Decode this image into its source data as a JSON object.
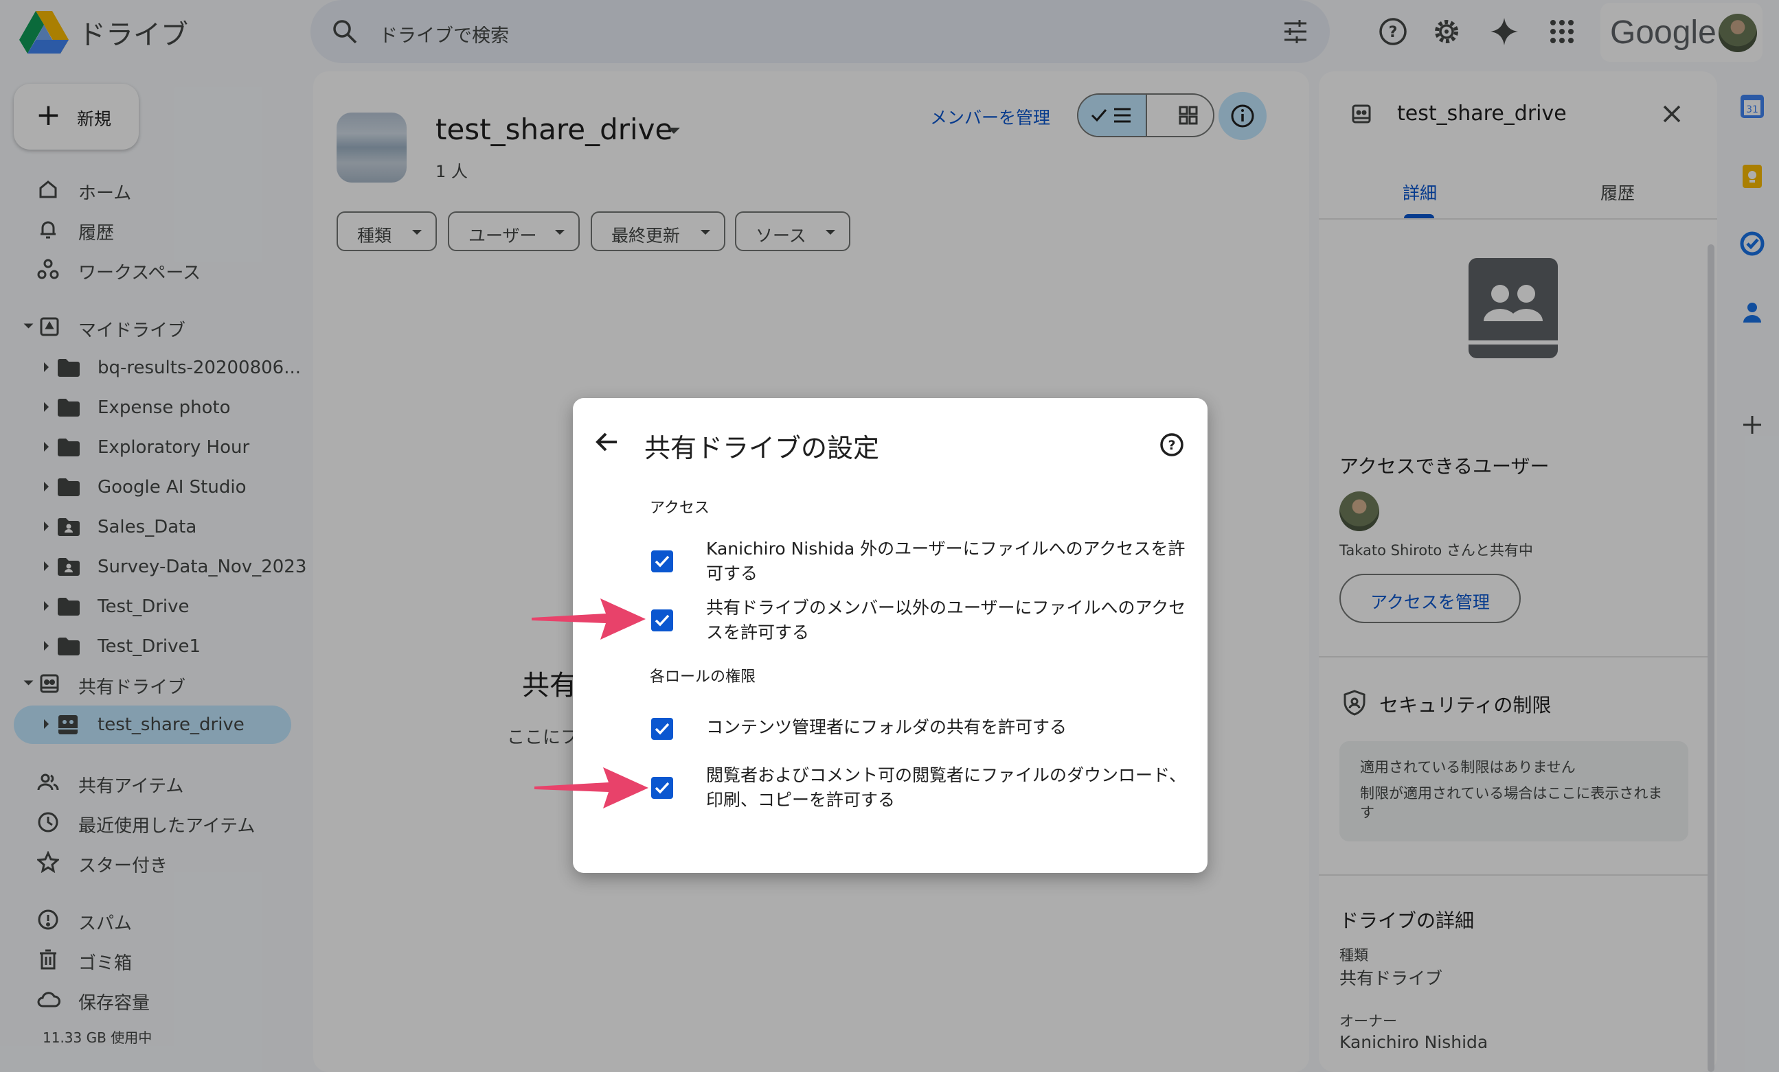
{
  "header": {
    "app_title": "ドライブ",
    "search_placeholder": "ドライブで検索",
    "google_word": "Google"
  },
  "sidebar": {
    "new_label": "新規",
    "nav_top": [
      {
        "label": "ホーム",
        "icon": "home-icon"
      },
      {
        "label": "履歴",
        "icon": "bell-icon"
      },
      {
        "label": "ワークスペース",
        "icon": "workspaces-icon"
      }
    ],
    "my_drive": {
      "label": "マイドライブ",
      "folders": [
        {
          "label": "bq-results-20200806...",
          "icon": "folder-icon"
        },
        {
          "label": "Expense photo",
          "icon": "folder-icon"
        },
        {
          "label": "Exploratory Hour",
          "icon": "folder-icon"
        },
        {
          "label": "Google AI Studio",
          "icon": "folder-icon"
        },
        {
          "label": "Sales_Data",
          "icon": "shared-folder-icon"
        },
        {
          "label": "Survey-Data_Nov_2023",
          "icon": "shared-folder-icon"
        },
        {
          "label": "Test_Drive",
          "icon": "folder-icon"
        },
        {
          "label": "Test_Drive1",
          "icon": "folder-icon"
        }
      ]
    },
    "shared_drives": {
      "label": "共有ドライブ",
      "items": [
        {
          "label": "test_share_drive"
        }
      ]
    },
    "nav_mid": [
      {
        "label": "共有アイテム",
        "icon": "people-icon"
      },
      {
        "label": "最近使用したアイテム",
        "icon": "clock-icon"
      },
      {
        "label": "スター付き",
        "icon": "star-icon"
      }
    ],
    "nav_bottom": [
      {
        "label": "スパム",
        "icon": "spam-icon"
      },
      {
        "label": "ゴミ箱",
        "icon": "trash-icon"
      },
      {
        "label": "保存容量",
        "icon": "cloud-icon"
      }
    ],
    "storage_used": "11.33 GB 使用中"
  },
  "main": {
    "drive_name": "test_share_drive",
    "member_count": "1 人",
    "manage_members": "メンバーを管理",
    "filters": [
      "種類",
      "ユーザー",
      "最終更新",
      "ソース"
    ],
    "empty_title": "共有",
    "empty_sub": "ここにフ"
  },
  "details_panel": {
    "title": "test_share_drive",
    "tabs": [
      "詳細",
      "履歴"
    ],
    "access_heading": "アクセスできるユーザー",
    "shared_with": "Takato Shiroto さんと共有中",
    "manage_access": "アクセスを管理",
    "security_heading": "セキュリティの制限",
    "security_line1": "適用されている制限はありません",
    "security_line2": "制限が適用されている場合はここに表示されます",
    "drive_details_heading": "ドライブの詳細",
    "type_label": "種類",
    "type_value": "共有ドライブ",
    "owner_label": "オーナー",
    "owner_value": "Kanichiro Nishida"
  },
  "dialog": {
    "title": "共有ドライブの設定",
    "access_section": "アクセス",
    "access_options": [
      {
        "text": "Kanichiro Nishida 外のユーザーにファイルへのアクセスを許可する",
        "checked": true
      },
      {
        "text": "共有ドライブのメンバー以外のユーザーにファイルへのアクセスを許可する",
        "checked": true
      }
    ],
    "roles_section": "各ロールの権限",
    "role_options": [
      {
        "text": "コンテンツ管理者にフォルダの共有を許可する",
        "checked": true
      },
      {
        "text": "閲覧者およびコメント可の閲覧者にファイルのダウンロード、印刷、コピーを許可する",
        "checked": true
      }
    ]
  },
  "colors": {
    "accent": "#0b57d0",
    "selection": "#c2e7ff",
    "annotation_arrow": "#e8426a"
  }
}
